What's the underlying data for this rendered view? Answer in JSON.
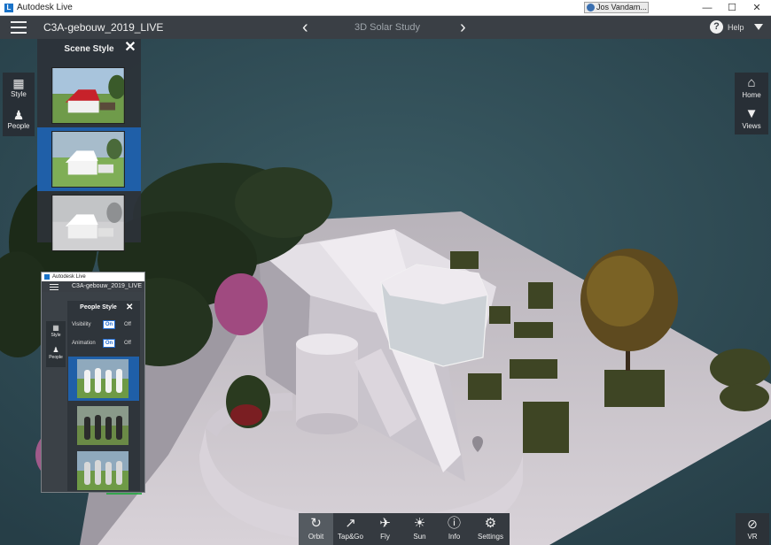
{
  "os": {
    "title": "Autodesk Live",
    "user": "Jos Vandam...",
    "minimize": "—",
    "maximize": "☐",
    "close": "✕"
  },
  "header": {
    "project_title": "C3A-gebouw_2019_LIVE",
    "prev": "‹",
    "next": "›",
    "view_title": "3D Solar Study",
    "help_glyph": "?",
    "help_label": "Help"
  },
  "left_rail": [
    {
      "label": "Style",
      "icon": "style-icon",
      "glyph": "▦"
    },
    {
      "label": "People",
      "icon": "people-icon",
      "glyph": "♟"
    }
  ],
  "right_rail": [
    {
      "label": "Home",
      "icon": "home-icon",
      "glyph": "⌂"
    },
    {
      "label": "Views",
      "icon": "location-pin-icon",
      "glyph": "▼"
    }
  ],
  "scene_panel": {
    "title": "Scene Style",
    "close": "✕",
    "thumbnails": [
      {
        "name": "realistic",
        "selected": false
      },
      {
        "name": "white-model",
        "selected": true
      },
      {
        "name": "grey-model",
        "selected": false
      }
    ]
  },
  "mini_window": {
    "title": "Autodesk Live",
    "project_title": "C3A-gebouw_2019_LIVE",
    "rail": [
      {
        "label": "Style",
        "glyph": "▦"
      },
      {
        "label": "People",
        "glyph": "♟"
      }
    ],
    "people_panel": {
      "title": "People Style",
      "close": "✕",
      "visibility_label": "Visibility",
      "animation_label": "Animation",
      "on": "On",
      "off": "Off",
      "thumbnails": [
        {
          "name": "white-people",
          "selected": true
        },
        {
          "name": "dark-people",
          "selected": false
        },
        {
          "name": "light-people",
          "selected": false
        }
      ]
    }
  },
  "toolbar": [
    {
      "label": "Orbit",
      "icon": "orbit-icon",
      "glyph": "↻",
      "active": true
    },
    {
      "label": "Tap&Go",
      "icon": "tap-go-icon",
      "glyph": "↗",
      "active": false
    },
    {
      "label": "Fly",
      "icon": "fly-icon",
      "glyph": "✈",
      "active": false
    },
    {
      "label": "Sun",
      "icon": "sun-icon",
      "glyph": "☀",
      "active": false
    },
    {
      "label": "Info",
      "icon": "info-icon",
      "glyph": "ⓘ",
      "active": false
    },
    {
      "label": "Settings",
      "icon": "settings-icon",
      "glyph": "⚙",
      "active": false
    }
  ],
  "vr": {
    "label": "VR",
    "glyph": "⊘"
  }
}
